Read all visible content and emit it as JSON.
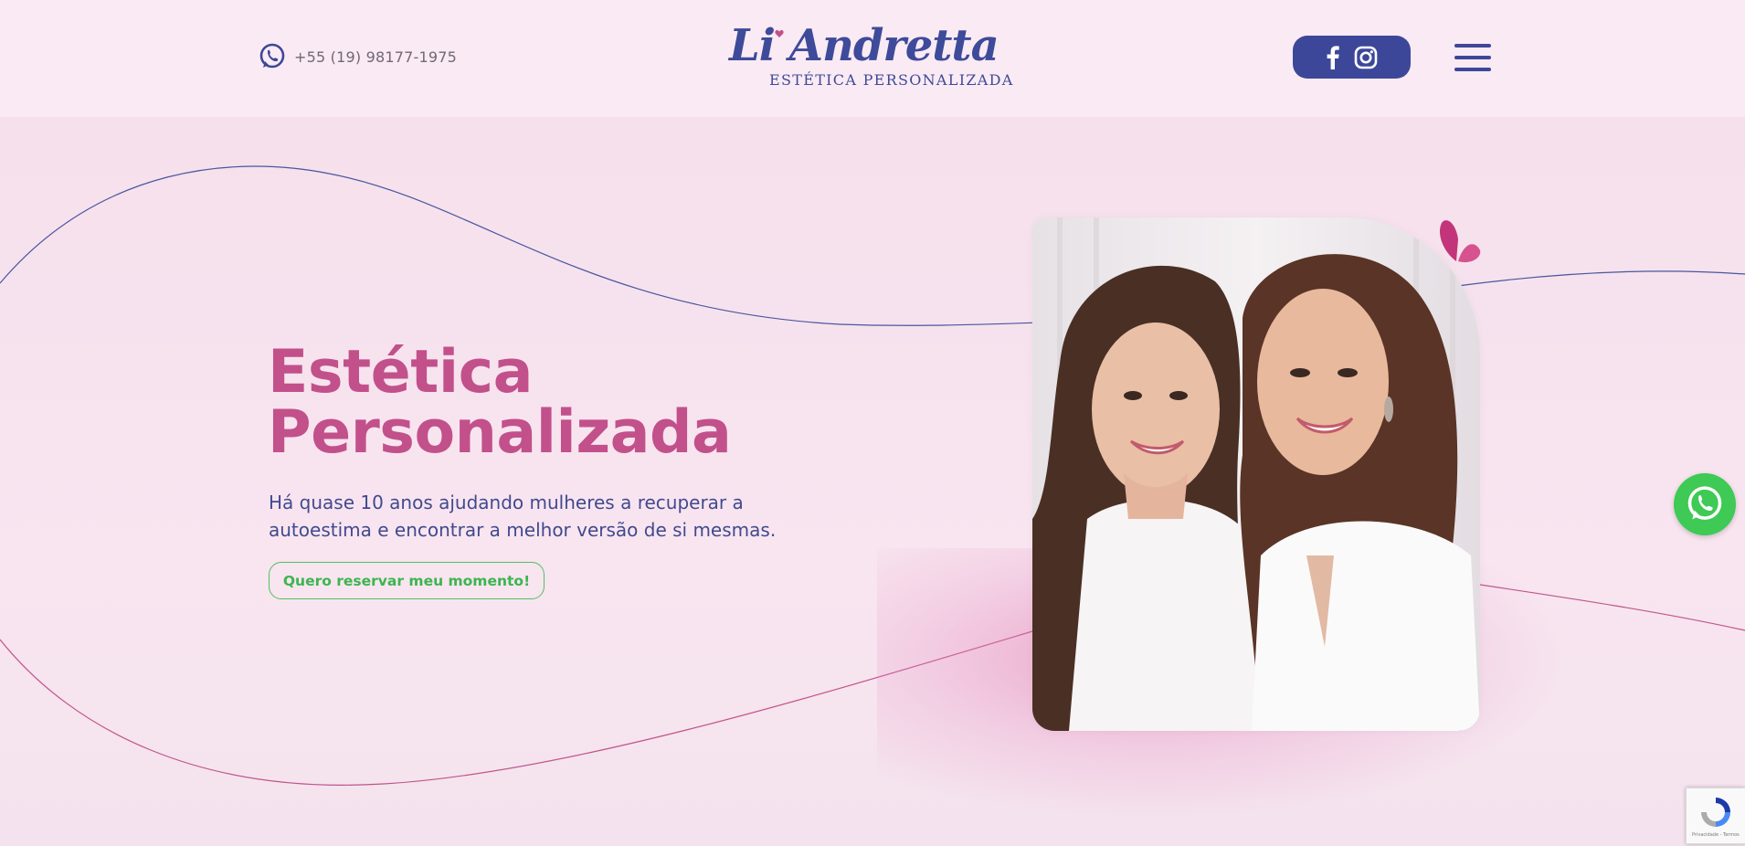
{
  "header": {
    "phone": "+55 (19) 98177-1975",
    "logo": {
      "script": "Li Andretta",
      "tagline": "ESTÉTICA PERSONALIZADA"
    },
    "social_icons": [
      "facebook-icon",
      "instagram-icon"
    ],
    "menu_icon": "hamburger-menu-icon"
  },
  "hero": {
    "title_line1": "Estética",
    "title_line2": "Personalizada",
    "subtitle": "Há quase 10 anos ajudando mulheres a recuperar a autoestima e encontrar a melhor versão de si mesmas.",
    "cta_label": "Quero reservar meu momento!"
  },
  "recaptcha": {
    "text": "Privacidade - Termos"
  },
  "colors": {
    "background": "#f8e6f1",
    "brand_blue": "#3d4799",
    "title_pink": "#c2508b",
    "cta_green": "#3cb54f",
    "whatsapp_green": "#3fc955"
  }
}
